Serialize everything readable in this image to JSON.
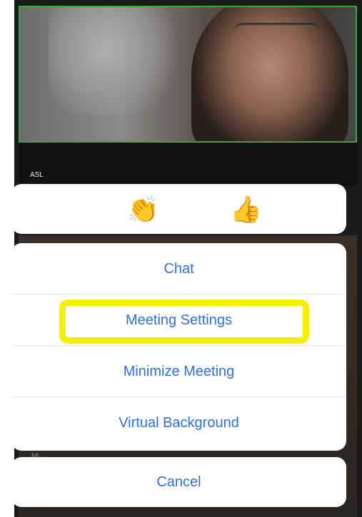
{
  "video": {
    "participant_label": "ASL",
    "secondary_label": "Mi..."
  },
  "reactions": [
    {
      "name": "clap",
      "glyph": "👏"
    },
    {
      "name": "thumbs-up",
      "glyph": "👍"
    }
  ],
  "menu": {
    "items": [
      {
        "label": "Chat"
      },
      {
        "label": "Meeting Settings"
      },
      {
        "label": "Minimize Meeting"
      },
      {
        "label": "Virtual Background"
      }
    ],
    "cancel_label": "Cancel"
  },
  "colors": {
    "accent": "#2f6fd6",
    "highlight": "#f6f000",
    "active_speaker_border": "#3aa83a"
  }
}
